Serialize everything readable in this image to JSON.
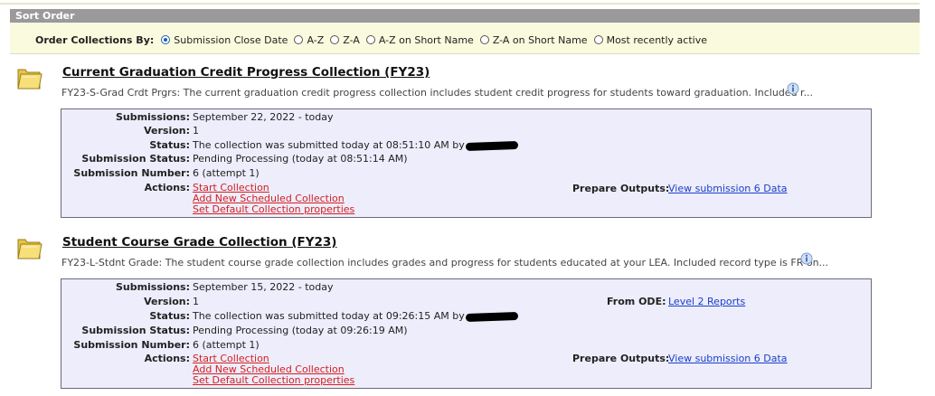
{
  "sort": {
    "header": "Sort Order",
    "label": "Order Collections By:",
    "options": [
      {
        "label": "Submission Close Date",
        "selected": true
      },
      {
        "label": "A-Z",
        "selected": false
      },
      {
        "label": "Z-A",
        "selected": false
      },
      {
        "label": "A-Z on Short Name",
        "selected": false
      },
      {
        "label": "Z-A on Short Name",
        "selected": false
      },
      {
        "label": "Most recently active",
        "selected": false
      }
    ]
  },
  "labels": {
    "submissions": "Submissions:",
    "version": "Version:",
    "status": "Status:",
    "submission_status": "Submission Status:",
    "submission_number": "Submission Number:",
    "actions": "Actions:",
    "prepare_outputs": "Prepare Outputs:",
    "from_ode": "From ODE:"
  },
  "collections": [
    {
      "title": "Current Graduation Credit Progress Collection (FY23)",
      "description": "FY23-S-Grad Crdt Prgrs: The current graduation credit progress collection includes student credit progress for students toward graduation. Included r...",
      "submissions": "September 22, 2022 - today",
      "version": "1",
      "status": "The collection was submitted today at 08:51:10 AM by",
      "submission_status": "Pending Processing (today at 08:51:14 AM)",
      "submission_number": "6 (attempt 1)",
      "actions": [
        "Start Collection",
        "Add New Scheduled Collection",
        "Set Default Collection properties"
      ],
      "prepare_outputs_link": "View submission 6 Data"
    },
    {
      "title": "Student Course Grade Collection (FY23)",
      "description": "FY23-L-Stdnt Grade: The student course grade collection includes grades and progress for students educated at your LEA. Included record type is FR on...",
      "submissions": "September 15, 2022 - today",
      "version": "1",
      "status": "The collection was submitted today at 09:26:15 AM by",
      "submission_status": "Pending Processing (today at 09:26:19 AM)",
      "submission_number": "6 (attempt 1)",
      "actions": [
        "Start Collection",
        "Add New Scheduled Collection",
        "Set Default Collection properties"
      ],
      "from_ode_link": "Level 2 Reports",
      "prepare_outputs_link": "View submission 6 Data"
    }
  ]
}
